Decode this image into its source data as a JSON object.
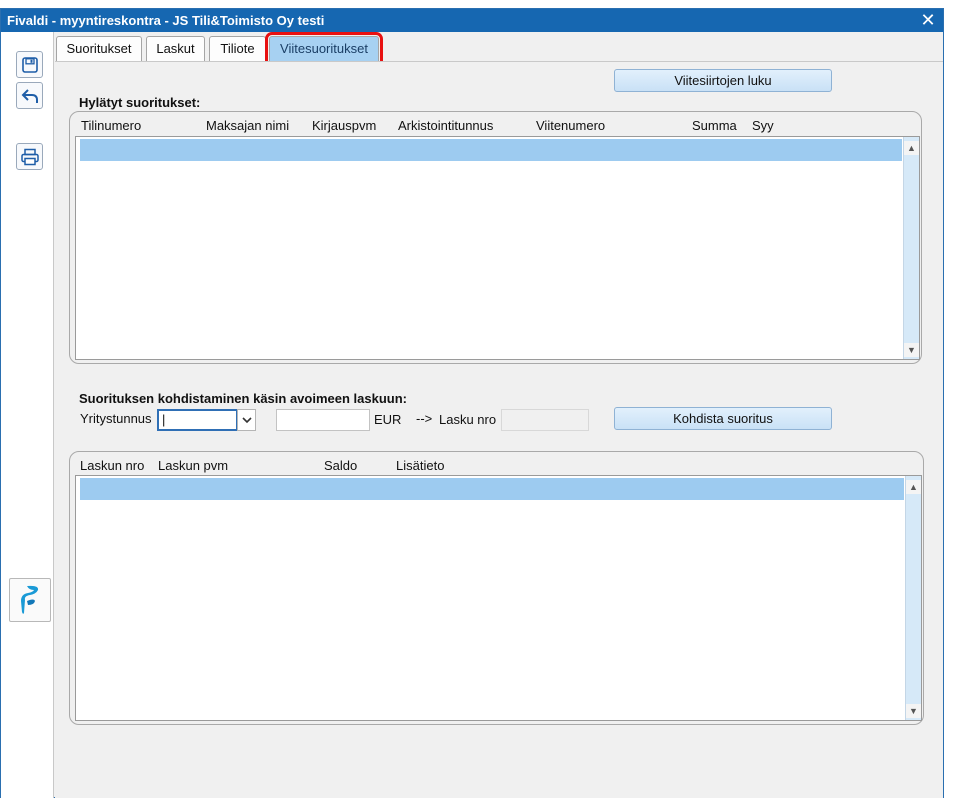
{
  "window": {
    "title": "Fivaldi - myyntireskontra - JS Tili&Toimisto Oy testi",
    "close_symbol": "✕"
  },
  "toolbar": {
    "icons": [
      "save-icon",
      "undo-icon",
      "print-icon"
    ],
    "logo": "fivaldi-logo-icon",
    "logo_color": "#1a9ad6"
  },
  "tabs": [
    {
      "label": "Suoritukset",
      "active": false
    },
    {
      "label": "Laskut",
      "active": false
    },
    {
      "label": "Tiliote",
      "active": false
    },
    {
      "label": "Viitesuoritukset",
      "active": true
    }
  ],
  "actions": {
    "read_references": "Viitesiirtojen luku",
    "allocate_payment": "Kohdista suoritus"
  },
  "rejected": {
    "title": "Hylätyt suoritukset:",
    "columns": [
      "Tilinumero",
      "Maksajan nimi",
      "Kirjauspvm",
      "Arkistointitunnus",
      "Viitenumero",
      "Summa",
      "Syy"
    ],
    "rows": []
  },
  "manual": {
    "title": "Suorituksen kohdistaminen käsin avoimeen laskuun:",
    "company_label": "Yritystunnus",
    "company_value": "|",
    "amount_value": "",
    "currency": "EUR",
    "arrow": "-->",
    "invoice_label": "Lasku nro",
    "invoice_value": ""
  },
  "invoices": {
    "columns": [
      "Laskun nro",
      "Laskun pvm",
      "Saldo",
      "Lisätieto"
    ],
    "rows": []
  },
  "colors": {
    "titlebar": "#1667b1",
    "selection": "#9dcbf0",
    "active_tab": "#a7d1f2",
    "highlight": "#e81010"
  }
}
